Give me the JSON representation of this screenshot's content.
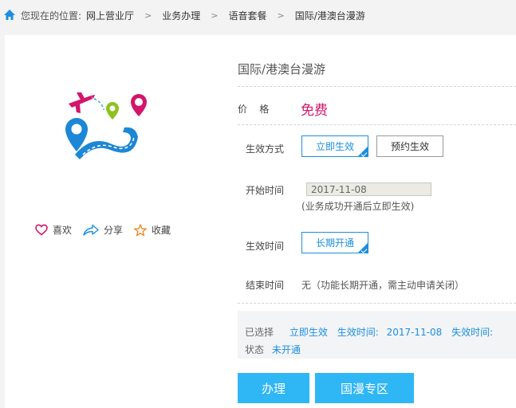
{
  "breadcrumb": {
    "location_label": "您现在的位置:",
    "items": [
      "网上营业厅",
      "业务办理",
      "语音套餐",
      "国际/港澳台漫游"
    ],
    "separator": ">"
  },
  "product": {
    "title": "国际/港澳台漫游",
    "price_label": "价    格",
    "price_value": "免费",
    "effect_mode_label": "生效方式",
    "effect_options": [
      "立即生效",
      "预约生效"
    ],
    "selected_effect": "立即生效",
    "start_time_label": "开始时间",
    "start_date": "2017-11-08",
    "start_note": "(业务成功开通后立即生效)",
    "effect_time_label": "生效时间",
    "effect_time_option": "长期开通",
    "end_time_label": "结束时间",
    "end_time_text": "无（功能长期开通，需主动申请关闭）"
  },
  "social": {
    "like": "喜欢",
    "share": "分享",
    "favorite": "收藏"
  },
  "summary": {
    "selected_label": "已选择",
    "selected_value": "立即生效",
    "effect_time_label": "生效时间:",
    "effect_time_value": "2017-11-08",
    "expire_time_label": "失效时间:",
    "status_label": "状态",
    "status_value": "未开通"
  },
  "actions": {
    "handle": "办理",
    "roaming_zone": "国漫专区"
  },
  "colors": {
    "accent_blue": "#1b8fe0",
    "button_blue": "#2fb6f5",
    "price_magenta": "#d3156c"
  }
}
